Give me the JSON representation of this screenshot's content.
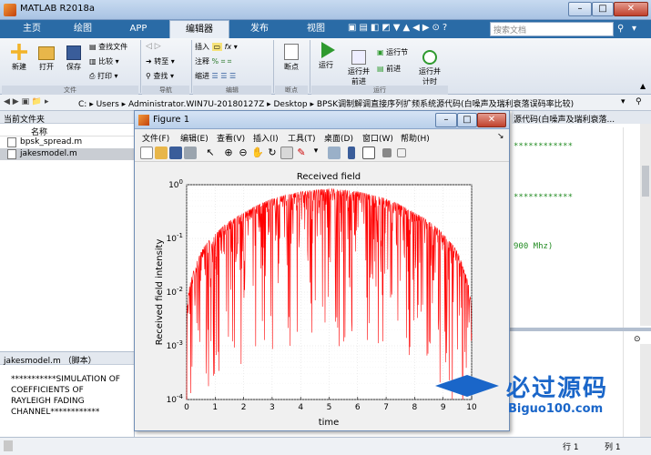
{
  "app": {
    "title": "MATLAB R2018a"
  },
  "tabs": [
    "主页",
    "绘图",
    "APP",
    "编辑器",
    "发布",
    "视图"
  ],
  "search": {
    "placeholder": "搜索文档"
  },
  "ribbon": {
    "file": {
      "new": "新建",
      "open": "打开",
      "save": "保存",
      "find_files": "查找文件",
      "compare": "比较",
      "print": "打印",
      "group": "文件"
    },
    "navigate": {
      "goto": "转至",
      "find": "查找",
      "group": "导航"
    },
    "edit": {
      "insert": "插入",
      "comment": "注释",
      "indent": "缩进",
      "group": "编辑"
    },
    "breakpoints": {
      "label": "断点",
      "group": "断点"
    },
    "run": {
      "run": "运行",
      "run_advance": "运行并\n前进",
      "run_section": "运行节",
      "advance": "前进",
      "run_time": "运行并\n计时",
      "group": "运行"
    }
  },
  "address": {
    "path": [
      "C:",
      "Users",
      "Administrator.WIN7U-20180127Z",
      "Desktop",
      "BPSK调制解调直接序列扩频系统源代码(白噪声及瑞利衰落误码率比较)"
    ]
  },
  "left_panel": {
    "title": "当前文件夹",
    "column": "名称",
    "files": [
      {
        "name": "bpsk_spread.m",
        "selected": false
      },
      {
        "name": "jakesmodel.m",
        "selected": true
      }
    ]
  },
  "details": {
    "title": "jakesmodel.m （脚本）",
    "text": "***********SIMULATION OF COEFFICIENTS OF RAYLEIGH FADING CHANNEL************"
  },
  "editor": {
    "title_fragment": "源代码(白噪声及瑞利衰落...",
    "line_stars1": "************",
    "line_stars2": "************",
    "line_mhz": "900 Mhz)"
  },
  "figure": {
    "title": "Figure 1",
    "menu": [
      "文件(F)",
      "编辑(E)",
      "查看(V)",
      "插入(I)",
      "工具(T)",
      "桌面(D)",
      "窗口(W)",
      "帮助(H)"
    ]
  },
  "chart_data": {
    "type": "line",
    "title": "Received field",
    "xlabel": "time",
    "ylabel": "Received field intensity",
    "xlim": [
      0,
      10
    ],
    "ylim_log10": [
      -4,
      0
    ],
    "yscale": "log",
    "xticks": [
      "0",
      "1",
      "2",
      "3",
      "4",
      "5",
      "6",
      "7",
      "8",
      "9",
      "10"
    ],
    "yticks": [
      "10^0",
      "10^-1",
      "10^-2",
      "10^-3",
      "10^-4"
    ],
    "grid": true,
    "series_color": "#ff0000",
    "envelope": {
      "x": [
        0,
        0.3,
        1,
        2,
        3,
        4,
        5,
        6,
        7,
        8,
        9,
        9.7,
        10
      ],
      "y": [
        0.004,
        0.03,
        0.12,
        0.3,
        0.55,
        0.75,
        0.85,
        0.75,
        0.55,
        0.3,
        0.12,
        0.03,
        0.004
      ]
    }
  },
  "status": {
    "row_label": "行",
    "row": "1",
    "col_label": "列",
    "col": "1"
  },
  "watermark": {
    "text": "必过源码",
    "sub": "Biguo100.com"
  }
}
